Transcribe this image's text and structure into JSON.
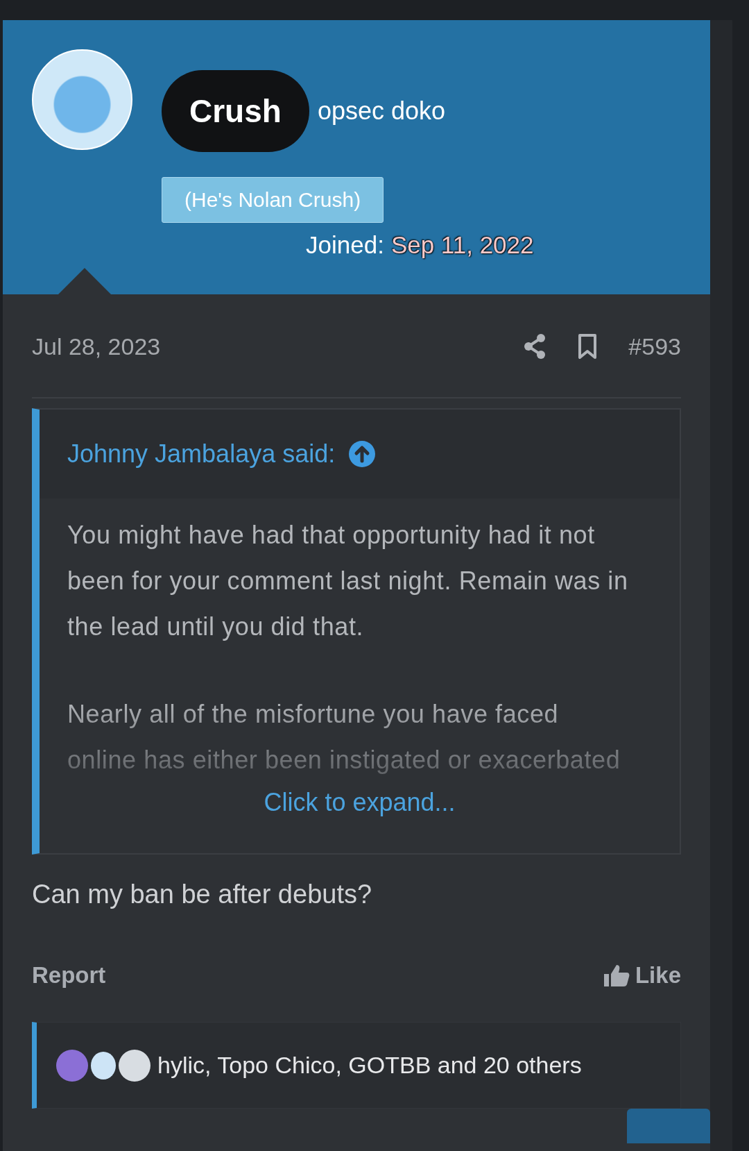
{
  "user": {
    "name": "Crush",
    "title": "opsec doko",
    "banner": "(He's Nolan Crush)",
    "joined_label": "Joined:",
    "joined_date": "Sep 11, 2022"
  },
  "post": {
    "date": "Jul 28, 2023",
    "number": "#593",
    "quote": {
      "author": "Johnny Jambalaya said:",
      "paragraphs": [
        "You might have had that opportunity had it not been for your comment last night. Remain was in the lead until you did that.",
        "Nearly all of the misfortune you have faced online has either been instigated or exacerbated"
      ],
      "expand": "Click to expand..."
    },
    "body": "Can my ban be after debuts?",
    "actions": [
      {
        "label": "Report",
        "kind": "report"
      },
      {
        "label": "Like",
        "kind": "like"
      }
    ],
    "reactions": {
      "text": "hylic, Topo Chico, GOTBB and 20 others"
    }
  }
}
